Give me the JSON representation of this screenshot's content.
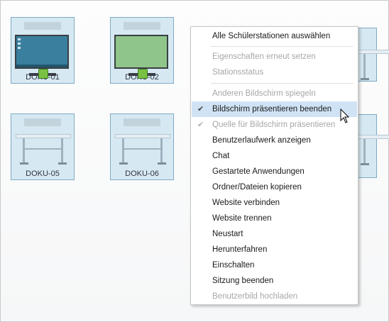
{
  "tiles": {
    "t1": {
      "label": "DOKU-01",
      "screen": "#3a7f9e",
      "screen_color": "blue-desktop"
    },
    "t2": {
      "label": "DOKU-02",
      "screen": "#8fc58a",
      "screen_color": "green"
    },
    "t5": {
      "label": "DOKU-05"
    },
    "t6": {
      "label": "DOKU-06"
    }
  },
  "menu": {
    "items": [
      {
        "label": "Alle Schülerstationen auswählen",
        "enabled": true
      },
      {
        "label": "Eigenschaften erneut setzen",
        "enabled": false
      },
      {
        "label": "Stationsstatus",
        "enabled": false
      },
      {
        "label": "Anderen Bildschirm spiegeln",
        "enabled": false
      },
      {
        "label": "Bildschirm präsentieren beenden",
        "enabled": true,
        "checked": true,
        "hover": true
      },
      {
        "label": "Quelle für Bildschirm präsentieren",
        "enabled": false,
        "checked": true
      },
      {
        "label": "Benutzerlaufwerk anzeigen",
        "enabled": true
      },
      {
        "label": "Chat",
        "enabled": true
      },
      {
        "label": "Gestartete Anwendungen",
        "enabled": true
      },
      {
        "label": "Ordner/Dateien kopieren",
        "enabled": true
      },
      {
        "label": "Website verbinden",
        "enabled": true
      },
      {
        "label": "Website trennen",
        "enabled": true
      },
      {
        "label": "Neustart",
        "enabled": true
      },
      {
        "label": "Herunterfahren",
        "enabled": true
      },
      {
        "label": "Einschalten",
        "enabled": true
      },
      {
        "label": "Sitzung beenden",
        "enabled": true
      },
      {
        "label": "Benutzerbild hochladen",
        "enabled": false
      }
    ],
    "check_glyph": "✔"
  },
  "colors": {
    "hover": "#cfe3f5",
    "tile_bg": "#d6e9f2",
    "tile_border": "#7fa9c4"
  }
}
